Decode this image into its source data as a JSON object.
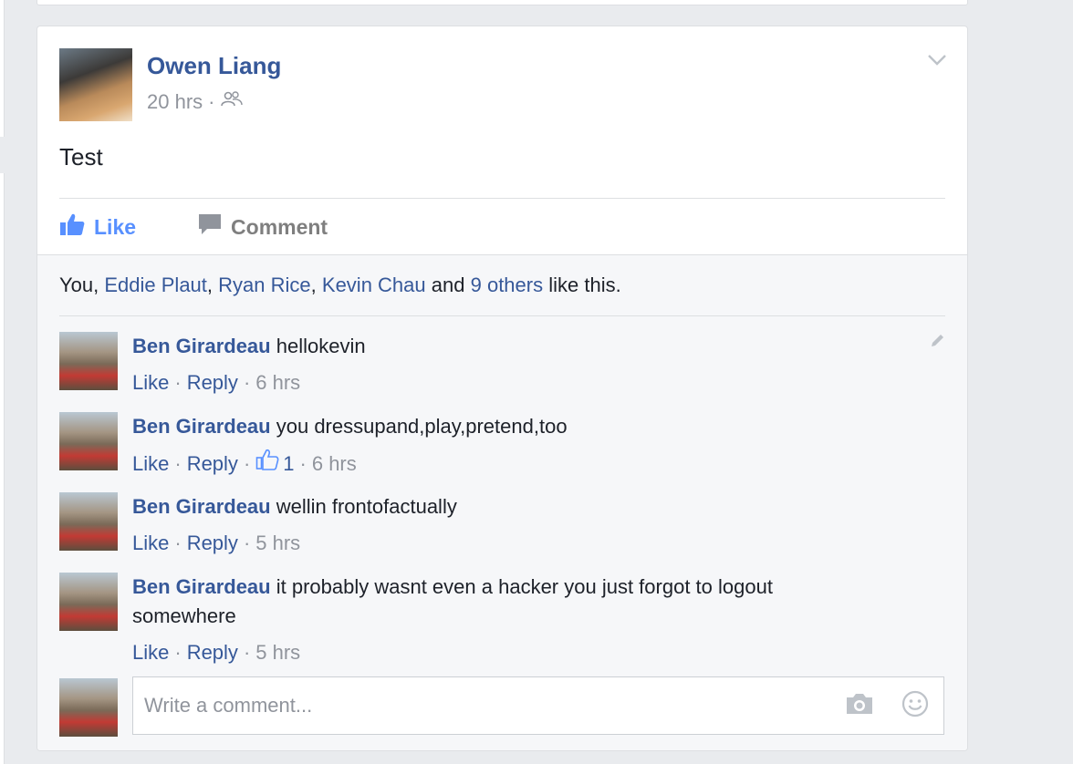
{
  "post": {
    "author": "Owen Liang",
    "time": "20 hrs",
    "separator": "·",
    "audience_icon": "friends-icon",
    "text": "Test",
    "actions": {
      "like": "Like",
      "comment": "Comment"
    }
  },
  "likes": {
    "you": "You,",
    "names": [
      "Eddie Plaut",
      "Ryan Rice",
      "Kevin Chau"
    ],
    "comma": ",",
    "and": "and",
    "others": "9 others",
    "suffix": "like this."
  },
  "comments": [
    {
      "author": "Ben Girardeau",
      "text": "hellokevin",
      "like": "Like",
      "reply": "Reply",
      "time": "6 hrs",
      "likes": null
    },
    {
      "author": "Ben Girardeau",
      "text": "you dressupand,play,pretend,too",
      "like": "Like",
      "reply": "Reply",
      "time": "6 hrs",
      "likes": "1"
    },
    {
      "author": "Ben Girardeau",
      "text": "wellin frontofactually",
      "like": "Like",
      "reply": "Reply",
      "time": "5 hrs",
      "likes": null
    },
    {
      "author": "Ben Girardeau",
      "text": "it probably wasnt even a hacker you just forgot to logout somewhere",
      "like": "Like",
      "reply": "Reply",
      "time": "5 hrs",
      "likes": null
    }
  ],
  "reply_box": {
    "placeholder": "Write a comment..."
  },
  "colors": {
    "link": "#365899",
    "like_active": "#5890ff",
    "muted": "#90949c",
    "text": "#1d2129"
  }
}
